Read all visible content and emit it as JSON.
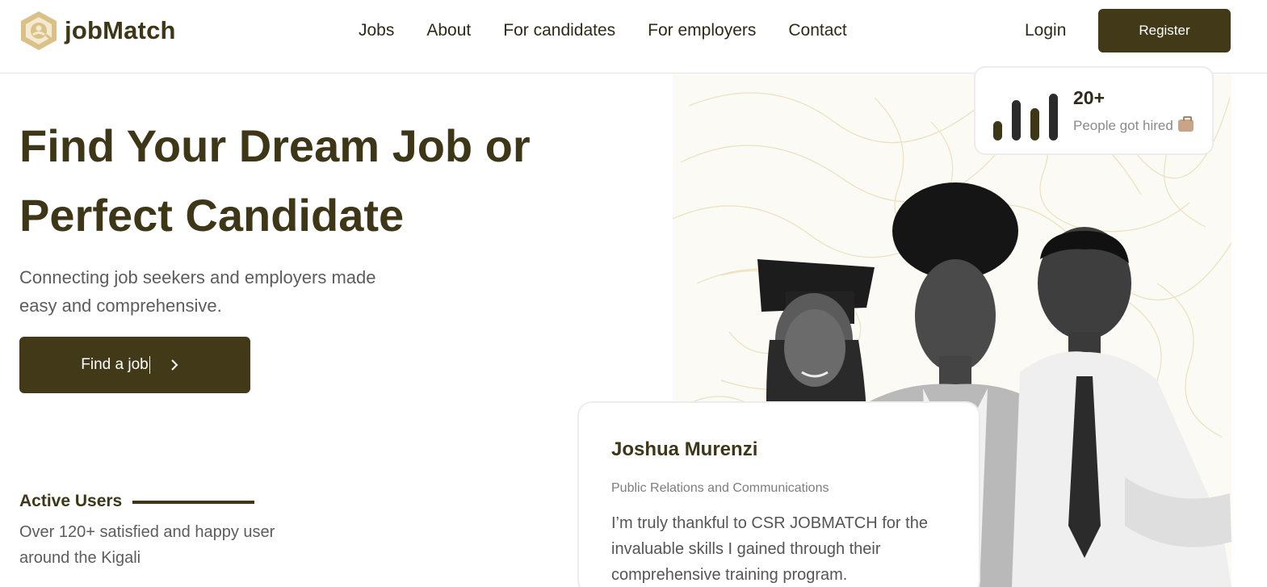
{
  "header": {
    "brand": "jobMatch",
    "nav": [
      "Jobs",
      "About",
      "For candidates",
      "For employers",
      "Contact"
    ],
    "login": "Login",
    "register": "Register"
  },
  "hero": {
    "title_line1": "Find Your Dream Job or",
    "title_line2": "Perfect Candidate",
    "subtitle": "Connecting job seekers and employers made easy and comprehensive.",
    "cta": "Find a job",
    "cta_icon": "chevron-right-icon"
  },
  "active_users": {
    "title": "Active Users",
    "description": "Over 120+ satisfied and happy user around the Kigali"
  },
  "stats_card": {
    "value": "20+",
    "label": "People got hired",
    "icon": "briefcase-icon"
  },
  "testimonial": {
    "name": "Joshua Murenzi",
    "role": "Public Relations and Communications",
    "quote": "I’m truly thankful to CSR JOBMATCH for the invaluable skills I gained through their comprehensive training program."
  },
  "colors": {
    "brand_dark": "#413918",
    "logo_gold": "#d7bf82",
    "text_gray": "#5c5c5c"
  }
}
